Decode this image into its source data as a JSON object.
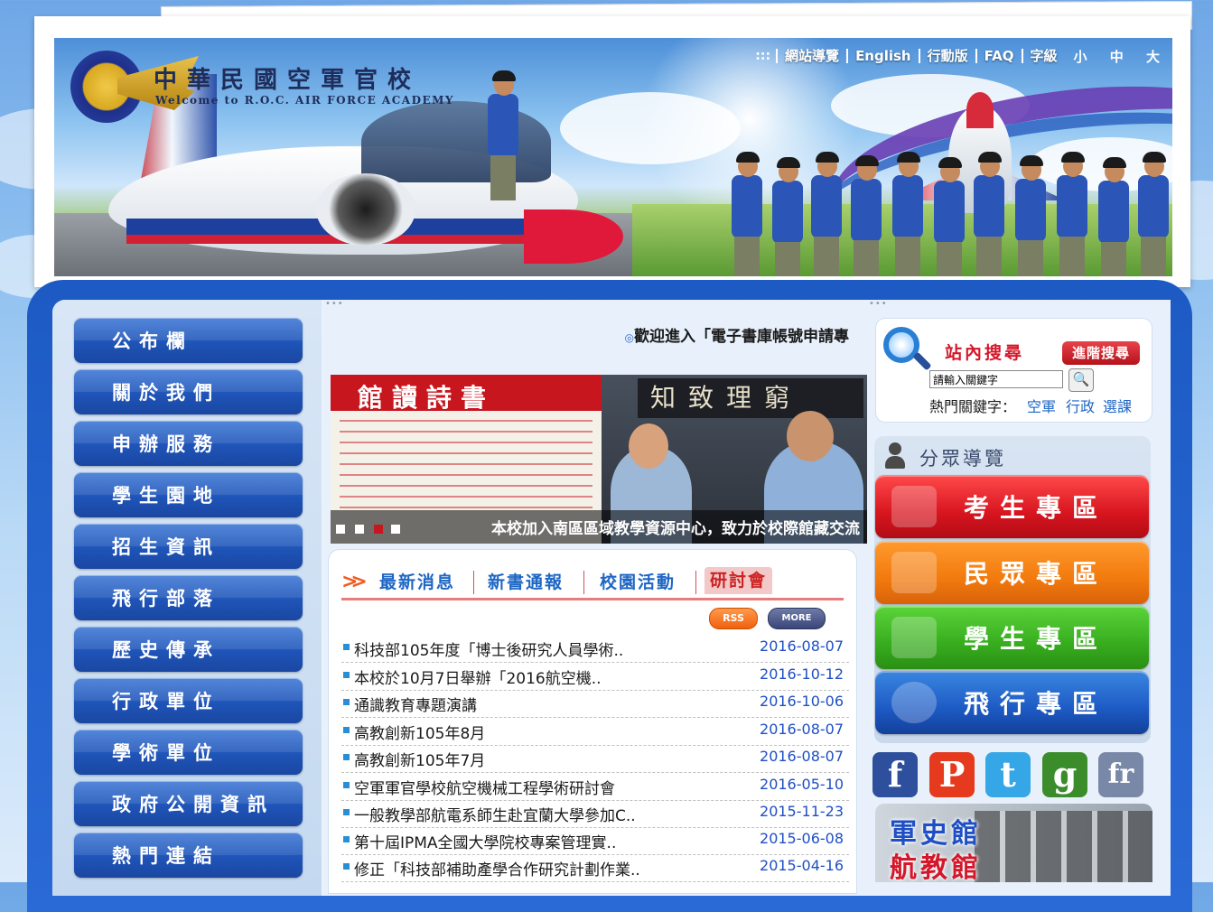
{
  "header": {
    "title": "中華民國空軍官校",
    "subtitle": "Welcome to R.O.C. AIR FORCE ACADEMY",
    "nav_dots": ":::",
    "nav_links": [
      "網站導覽",
      "English",
      "行動版",
      "FAQ",
      "字級"
    ],
    "font_sizes": "小 中 大"
  },
  "sidebar": {
    "items": [
      {
        "label": "公布欄"
      },
      {
        "label": "關於我們"
      },
      {
        "label": "申辦服務"
      },
      {
        "label": "學生園地"
      },
      {
        "label": "招生資訊"
      },
      {
        "label": "飛行部落"
      },
      {
        "label": "歷史傳承"
      },
      {
        "label": "行政單位"
      },
      {
        "label": "學術單位"
      },
      {
        "label": "政府公開資訊"
      },
      {
        "label": "熱門連結"
      }
    ]
  },
  "marquee": {
    "bullet": "◎",
    "text": "歡迎進入「電子書庫帳號申請專"
  },
  "slideshow": {
    "banner_text": "館讀詩書",
    "plaque_text": "知致理窮",
    "caption": "本校加入南區區域教學資源中心，致力於校際館藏交流",
    "active_index": 3,
    "count": 4
  },
  "news": {
    "tabs": [
      "最新消息",
      "新書通報",
      "校園活動",
      "研討會"
    ],
    "active_tab": "研討會",
    "rss_label": "RSS",
    "more_label": "MORE",
    "items": [
      {
        "title": "科技部105年度「博士後研究人員學術..",
        "date": "2016-08-07"
      },
      {
        "title": "本校於10月7日舉辦「2016航空機..",
        "date": "2016-10-12"
      },
      {
        "title": "通識教育專題演講",
        "date": "2016-10-06"
      },
      {
        "title": "高教創新105年8月",
        "date": "2016-08-07"
      },
      {
        "title": "高教創新105年7月",
        "date": "2016-08-07"
      },
      {
        "title": "空軍軍官學校航空機械工程學術研討會",
        "date": "2016-05-10"
      },
      {
        "title": "一般教學部航電系師生赴宜蘭大學參加C..",
        "date": "2015-11-23"
      },
      {
        "title": "第十屆IPMA全國大學院校專案管理實..",
        "date": "2015-06-08"
      },
      {
        "title": "修正「科技部補助產學合作研究計劃作業..",
        "date": "2015-04-16"
      }
    ]
  },
  "search": {
    "title": "站內搜尋",
    "advanced_label": "進階搜尋",
    "placeholder": "請輸入關鍵字",
    "hot_label": "熱門關鍵字：",
    "hot_keywords": [
      "空軍",
      "行政",
      "選課"
    ]
  },
  "audience_nav": {
    "title": "分眾導覽",
    "zones": [
      {
        "label": "考生專區",
        "color": "#d8151f"
      },
      {
        "label": "民眾專區",
        "color": "#f27a0e"
      },
      {
        "label": "學生專區",
        "color": "#37ad1e"
      },
      {
        "label": "飛行專區",
        "color": "#1d5ac4"
      }
    ]
  },
  "social": [
    {
      "name": "facebook",
      "glyph": "f",
      "color": "#2d4f9c"
    },
    {
      "name": "plurk",
      "glyph": "P",
      "color": "#e63a1e"
    },
    {
      "name": "twitter",
      "glyph": "t",
      "color": "#35a6e6"
    },
    {
      "name": "google",
      "glyph": "g",
      "color": "#3a8d2a"
    },
    {
      "name": "flickr",
      "glyph": "fr",
      "color": "#7a88a8"
    }
  ],
  "museum": {
    "line1": "軍史館",
    "line2": "航教館"
  }
}
